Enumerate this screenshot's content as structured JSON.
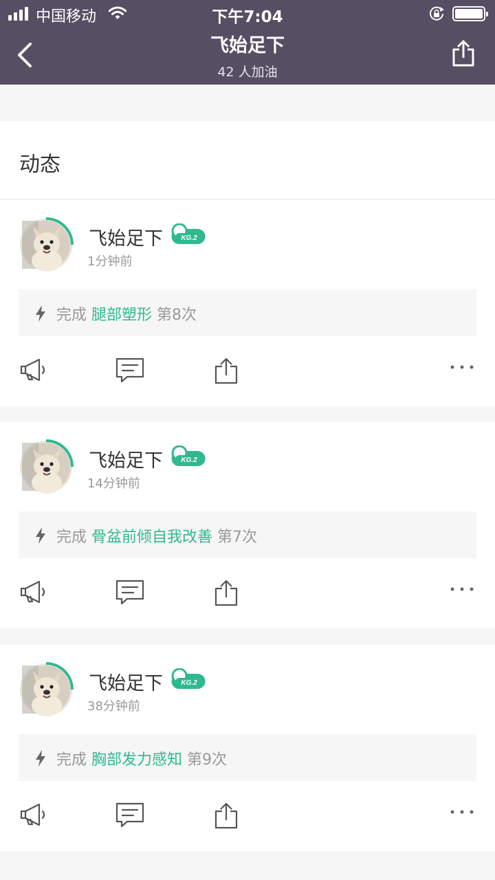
{
  "status_bar": {
    "carrier": "中国移动",
    "time": "下午7:04"
  },
  "header": {
    "title": "飞始足下",
    "subtitle": "42 人加油"
  },
  "section": {
    "title": "动态"
  },
  "colors": {
    "header_bg": "#564e63",
    "accent": "#2fb98f"
  },
  "feed": [
    {
      "name": "飞始足下",
      "time": "1分钟前",
      "action": "完成",
      "course": "腿部塑形",
      "count": "第8次",
      "badge": "KG.2"
    },
    {
      "name": "飞始足下",
      "time": "14分钟前",
      "action": "完成",
      "course": "骨盆前倾自我改善",
      "count": "第7次",
      "badge": "KG.2"
    },
    {
      "name": "飞始足下",
      "time": "38分钟前",
      "action": "完成",
      "course": "胸部发力感知",
      "count": "第9次",
      "badge": "KG.2"
    }
  ]
}
